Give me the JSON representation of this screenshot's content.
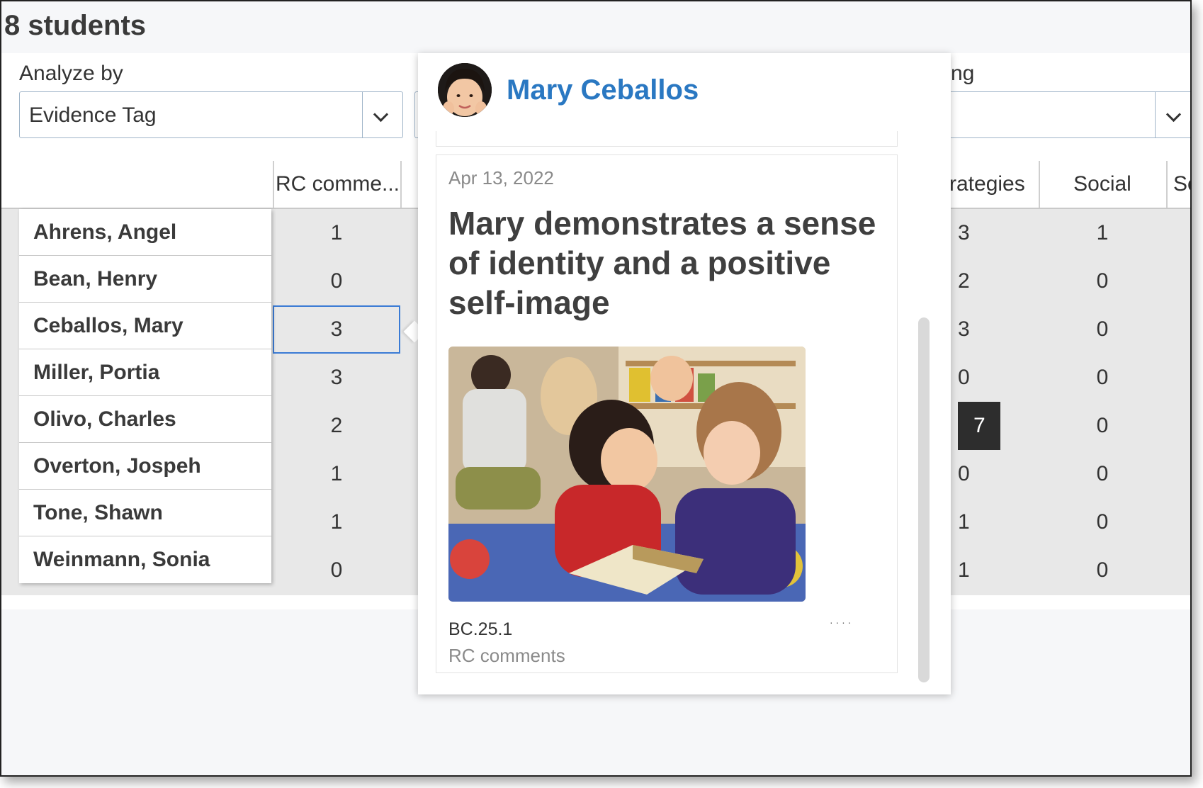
{
  "page": {
    "title": "8 students"
  },
  "filters": {
    "analyze_label": "Analyze by",
    "analyze_value": "Evidence Tag",
    "right_label_fragment": "ng"
  },
  "table": {
    "columns": [
      "RC comme...",
      "rategies",
      "Social",
      "So"
    ],
    "rows": [
      {
        "name": "Ahrens, Angel",
        "rc": "1",
        "strategies": "3",
        "social": "1"
      },
      {
        "name": "Bean, Henry",
        "rc": "0",
        "strategies": "2",
        "social": "0"
      },
      {
        "name": "Ceballos, Mary",
        "rc": "3",
        "strategies": "3",
        "social": "0"
      },
      {
        "name": "Miller, Portia",
        "rc": "3",
        "strategies": "0",
        "social": "0"
      },
      {
        "name": "Olivo, Charles",
        "rc": "2",
        "strategies": "7",
        "social": "0"
      },
      {
        "name": "Overton, Jospeh",
        "rc": "1",
        "strategies": "0",
        "social": "0"
      },
      {
        "name": "Tone, Shawn",
        "rc": "1",
        "strategies": "1",
        "social": "0"
      },
      {
        "name": "Weinmann, Sonia",
        "rc": "0",
        "strategies": "1",
        "social": "0"
      }
    ],
    "selected_row": 2,
    "highlight": {
      "row": 4,
      "column": "strategies",
      "color": "#2d2d2d"
    }
  },
  "popup": {
    "student_name": "Mary Ceballos",
    "name_color": "#2a78c2",
    "card": {
      "date": "Apr 13, 2022",
      "headline": "Mary demonstrates a sense of identity and a positive self-image",
      "code": "BC.25.1",
      "tag": "RC comments"
    }
  },
  "colors": {
    "accent": "#3a7bd5",
    "cell_bg": "#e8e8e8",
    "band_bg": "#f6f7f9"
  }
}
